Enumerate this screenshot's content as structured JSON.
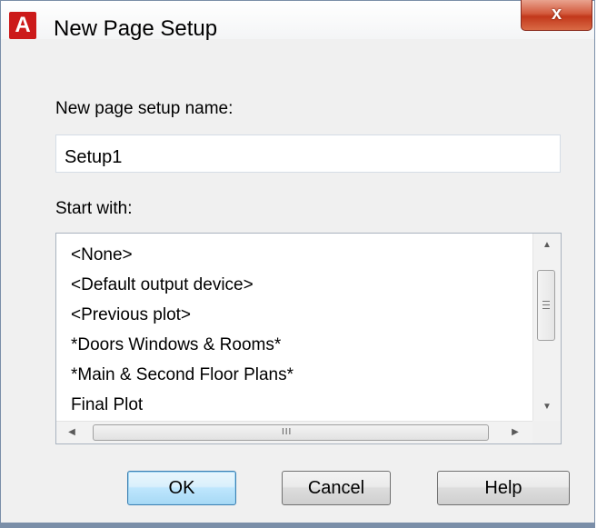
{
  "window": {
    "title": "New Page Setup",
    "app_icon_letter": "A",
    "close_symbol": "x"
  },
  "form": {
    "name_label": "New page setup name:",
    "name_value": "Setup1",
    "start_label": "Start with:"
  },
  "list": {
    "items": [
      "<None>",
      "<Default output device>",
      "<Previous plot>",
      "*Doors Windows & Rooms*",
      "*Main & Second Floor Plans*",
      "Final Plot"
    ]
  },
  "scroll": {
    "up_glyph": "▲",
    "down_glyph": "▼",
    "left_glyph": "◀",
    "right_glyph": "▶",
    "h_grip": "III"
  },
  "buttons": {
    "ok": "OK",
    "cancel": "Cancel",
    "help": "Help"
  },
  "colors": {
    "app_icon": "#cc1a1a",
    "close_button": "#c2381b",
    "default_button_border": "#3c7fb1"
  }
}
